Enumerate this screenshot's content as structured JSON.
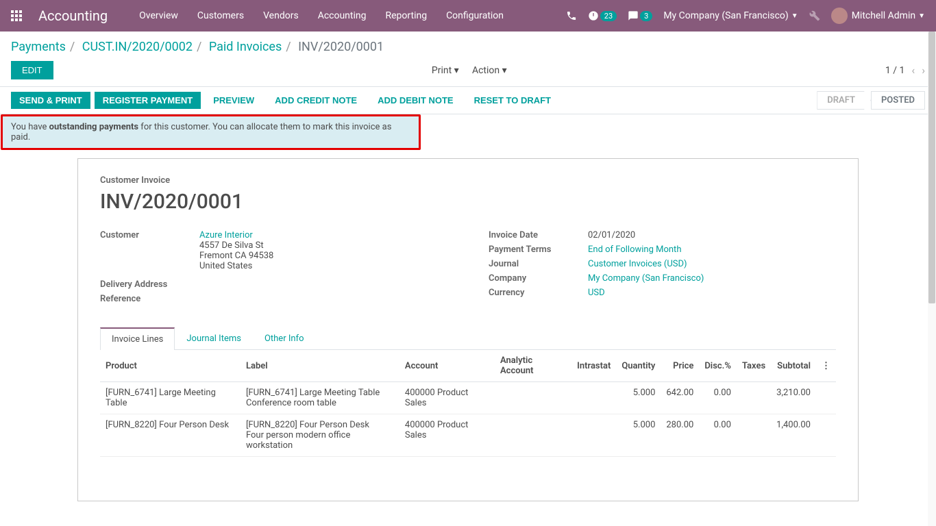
{
  "topbar": {
    "app": "Accounting",
    "nav": [
      "Overview",
      "Customers",
      "Vendors",
      "Accounting",
      "Reporting",
      "Configuration"
    ],
    "badge1": "23",
    "badge2": "3",
    "company": "My Company (San Francisco)",
    "user": "Mitchell Admin"
  },
  "breadcrumb": {
    "items": [
      "Payments",
      "CUST.IN/2020/0002",
      "Paid Invoices"
    ],
    "current": "INV/2020/0001"
  },
  "controls": {
    "edit": "EDIT",
    "print": "Print",
    "action": "Action",
    "pager": "1 / 1"
  },
  "buttons": {
    "send_print": "SEND & PRINT",
    "register_payment": "REGISTER PAYMENT",
    "preview": "PREVIEW",
    "add_credit": "ADD CREDIT NOTE",
    "add_debit": "ADD DEBIT NOTE",
    "reset_draft": "RESET TO DRAFT",
    "status_draft": "DRAFT",
    "status_posted": "POSTED"
  },
  "banner": {
    "pre": "You have ",
    "bold": "outstanding payments",
    "post": " for this customer. You can allocate them to mark this invoice as paid."
  },
  "invoice": {
    "type_label": "Customer Invoice",
    "number": "INV/2020/0001",
    "left": {
      "customer_label": "Customer",
      "customer_name": "Azure Interior",
      "addr1": "4557 De Silva St",
      "addr2": "Fremont CA 94538",
      "addr3": "United States",
      "delivery_label": "Delivery Address",
      "reference_label": "Reference"
    },
    "right": {
      "date_label": "Invoice Date",
      "date_val": "02/01/2020",
      "terms_label": "Payment Terms",
      "terms_val": "End of Following Month",
      "journal_label": "Journal",
      "journal_val": "Customer Invoices (USD)",
      "company_label": "Company",
      "company_val": "My Company (San Francisco)",
      "currency_label": "Currency",
      "currency_val": "USD"
    }
  },
  "tabs": [
    "Invoice Lines",
    "Journal Items",
    "Other Info"
  ],
  "columns": {
    "product": "Product",
    "label": "Label",
    "account": "Account",
    "analytic": "Analytic Account",
    "intrastat": "Intrastat",
    "quantity": "Quantity",
    "price": "Price",
    "disc": "Disc.%",
    "taxes": "Taxes",
    "subtotal": "Subtotal"
  },
  "lines": [
    {
      "product": "[FURN_6741] Large Meeting Table",
      "label": "[FURN_6741] Large Meeting Table\nConference room table",
      "account": "400000 Product Sales",
      "analytic": "",
      "intrastat": "",
      "quantity": "5.000",
      "price": "642.00",
      "disc": "0.00",
      "taxes": "",
      "subtotal": "3,210.00"
    },
    {
      "product": "[FURN_8220] Four Person Desk",
      "label": "[FURN_8220] Four Person Desk\nFour person modern office workstation",
      "account": "400000 Product Sales",
      "analytic": "",
      "intrastat": "",
      "quantity": "5.000",
      "price": "280.00",
      "disc": "0.00",
      "taxes": "",
      "subtotal": "1,400.00"
    }
  ]
}
